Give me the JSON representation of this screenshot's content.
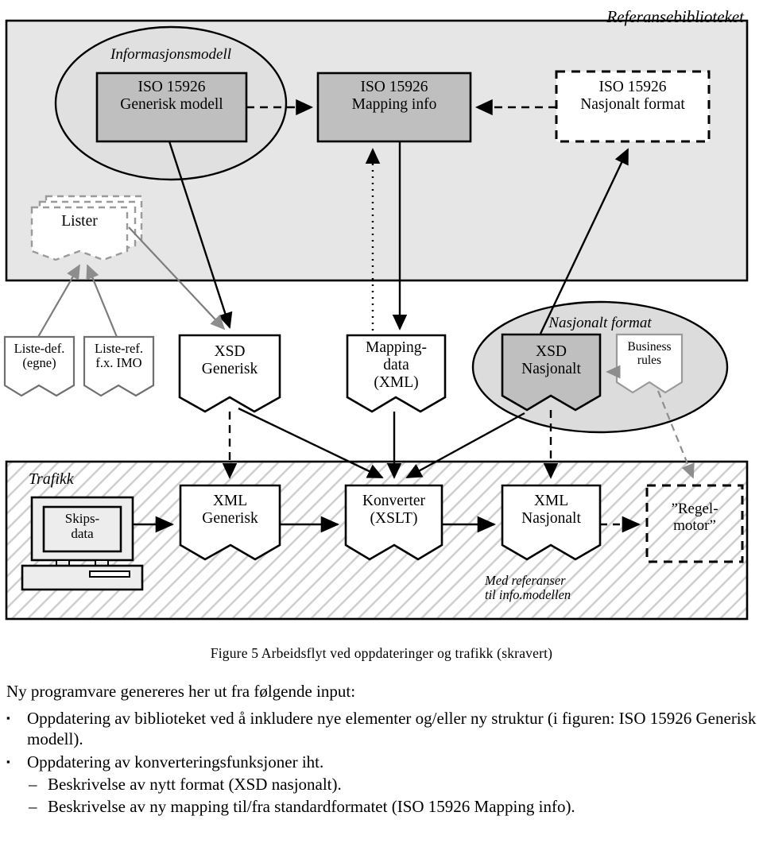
{
  "figure": {
    "panels": {
      "reference_library": {
        "title": "Referansebiblioteket",
        "fill": "#e6e6e6"
      },
      "traffic": {
        "title": "Trafikk",
        "hatch": true
      }
    },
    "groups": [
      {
        "name": "informasjonsmodell-ellipse",
        "title": "Informasjonsmodell"
      },
      {
        "name": "nasjonalt-format-ellipse",
        "title": "Nasjonalt format"
      }
    ],
    "nodes": {
      "iso_generisk_modell": {
        "line1": "ISO 15926",
        "line2": "Generisk modell",
        "fill": "#bfbfbf",
        "shape": "rect"
      },
      "iso_mapping_info": {
        "line1": "ISO 15926",
        "line2": "Mapping info",
        "fill": "#bfbfbf",
        "shape": "rect"
      },
      "iso_nasjonalt_format": {
        "line1": "ISO 15926",
        "line2": "Nasjonalt format",
        "fill": "#ffffff",
        "shape": "rect-dashed"
      },
      "lister": {
        "line1": "Lister",
        "shape": "document-stack-dashed"
      },
      "liste_def": {
        "line1": "Liste-def.",
        "line2": "(egne)",
        "shape": "document"
      },
      "liste_ref": {
        "line1": "Liste-ref.",
        "line2": "f.x. IMO",
        "shape": "document"
      },
      "xsd_generisk": {
        "line1": "XSD",
        "line2": "Generisk",
        "shape": "document"
      },
      "mapping_data": {
        "line1": "Mapping-",
        "line2": "data",
        "line3": "(XML)",
        "shape": "document"
      },
      "xsd_nasjonalt": {
        "line1": "XSD",
        "line2": "Nasjonalt",
        "fill": "#bfbfbf",
        "shape": "document"
      },
      "business_rules": {
        "line1": "Business",
        "line2": "rules",
        "shape": "document"
      },
      "skipsdata": {
        "line1": "Skips-",
        "line2": "data",
        "shape": "computer"
      },
      "xml_generisk": {
        "line1": "XML",
        "line2": "Generisk",
        "shape": "document"
      },
      "konverter": {
        "line1": "Konverter",
        "line2": "(XSLT)",
        "shape": "document"
      },
      "xml_nasjonalt": {
        "line1": "XML",
        "line2": "Nasjonalt",
        "shape": "document"
      },
      "regelmotor": {
        "line1": "”Regel-",
        "line2": "motor”",
        "shape": "rect-dashed"
      }
    },
    "annotations": {
      "med_referanser": {
        "line1": "Med   referanser",
        "line2": "til info.modellen"
      }
    }
  },
  "caption": "Figure 5  Arbeidsflyt ved oppdateringer og trafikk (skravert)",
  "body": {
    "lead": "Ny programvare genereres her ut fra følgende input:",
    "bullet_marker": "▪",
    "dash_marker": "–",
    "bullets": [
      {
        "text": "Oppdatering av biblioteket ved å inkludere nye elementer og/eller ny struktur (i figuren: ISO 15926 Generisk modell).",
        "subs": []
      },
      {
        "text": "Oppdatering av konverteringsfunksjoner iht.",
        "subs": [
          "Beskrivelse av nytt format (XSD nasjonalt).",
          "Beskrivelse av ny mapping til/fra standardformatet (ISO 15926 Mapping info)."
        ]
      }
    ]
  }
}
